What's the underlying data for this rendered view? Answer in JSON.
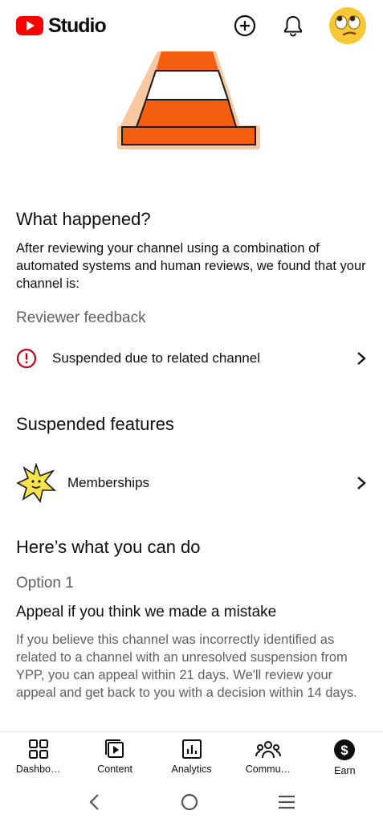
{
  "header": {
    "app_name": "Studio",
    "brand_color": "#ff0000"
  },
  "what_happened": {
    "title": "What happened?",
    "description": "After reviewing your channel using a combination of automated systems and human reviews, we found that your channel is:",
    "feedback_title": "Reviewer feedback",
    "feedback_item": "Suspended due to related channel",
    "alert_color": "#c00015"
  },
  "suspended": {
    "title": "Suspended features",
    "feature_label": "Memberships"
  },
  "actions": {
    "title": "Here’s what you can do",
    "option_label": "Option 1",
    "option_title": "Appeal if you think we made a mistake",
    "option_description": "If you believe this channel was incorrectly identified as related to a channel with an unresolved suspension from YPP, you can appeal within 21 days. We'll review your appeal and get back to you with a decision within 14 days."
  },
  "bottom_nav": {
    "items": [
      {
        "label": "Dashbo…",
        "icon": "dashboard-icon"
      },
      {
        "label": "Content",
        "icon": "content-icon"
      },
      {
        "label": "Analytics",
        "icon": "analytics-icon"
      },
      {
        "label": "Commu…",
        "icon": "community-icon"
      },
      {
        "label": "Earn",
        "icon": "earn-icon"
      }
    ]
  }
}
